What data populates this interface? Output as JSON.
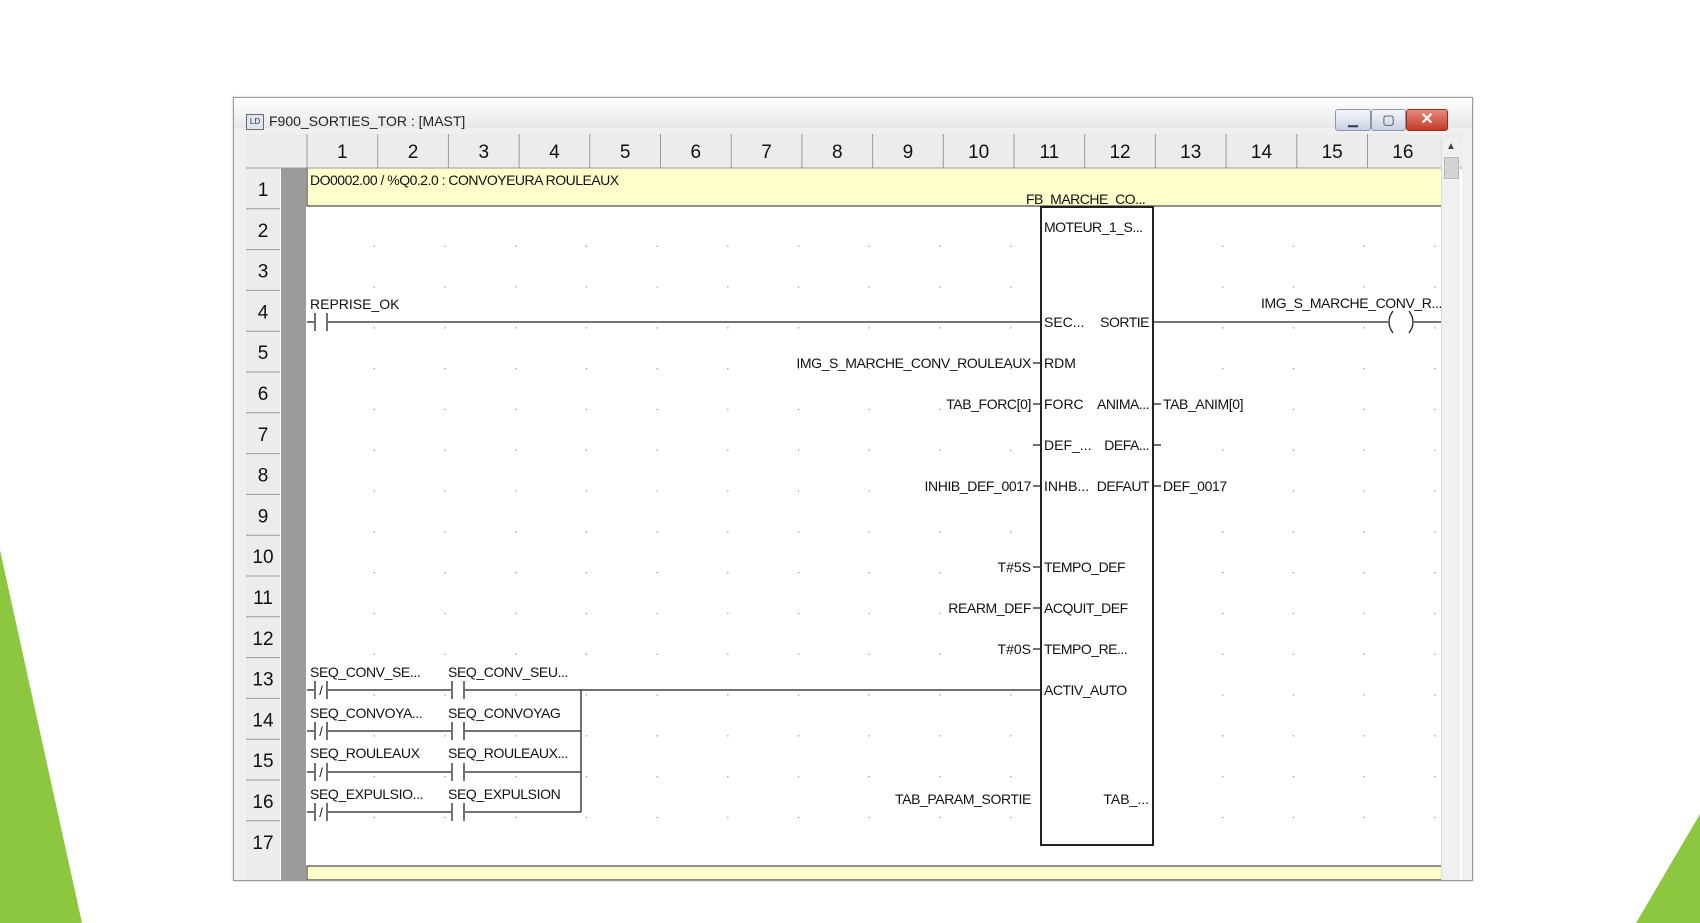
{
  "window": {
    "title": "F900_SORTIES_TOR : [MAST]",
    "icon": "ladder-editor-icon",
    "minimize_icon": "minimize-icon",
    "maximize_icon": "maximize-icon",
    "close_icon": "close-icon"
  },
  "grid": {
    "column_headers": [
      "1",
      "2",
      "3",
      "4",
      "5",
      "6",
      "7",
      "8",
      "9",
      "10",
      "11",
      "12",
      "13",
      "14",
      "15",
      "16"
    ],
    "row_headers": [
      "1",
      "2",
      "3",
      "4",
      "5",
      "6",
      "7",
      "8",
      "9",
      "10",
      "11",
      "12",
      "13",
      "14",
      "15",
      "16",
      "17"
    ]
  },
  "rung": {
    "comment": "DO0002.00 / %Q0.2.0 : CONVOYEURA ROULEAUX"
  },
  "contacts": {
    "reprise": "REPRISE_OK",
    "r13a": "SEQ_CONV_SE...",
    "r13b": "SEQ_CONV_SEU...",
    "r14a": "SEQ_CONVOYA...",
    "r14b": "SEQ_CONVOYAG",
    "r15a": "SEQ_ROULEAUX",
    "r15b": "SEQ_ROULEAUX...",
    "r16a": "SEQ_EXPULSIO...",
    "r16b": "SEQ_EXPULSION",
    "negated_symbol": "/"
  },
  "fb": {
    "instance": "FB_MARCHE_CO...",
    "type": "MOTEUR_1_S...",
    "inputs": {
      "sec": "SEC...",
      "rdm": "RDM",
      "forc": "FORC",
      "def": "DEF_...",
      "inhb": "INHB...",
      "tempo_def": "TEMPO_DEF",
      "acquit_def": "ACQUIT_DEF",
      "tempo_re": "TEMPO_RE...",
      "activ_auto": "ACTIV_AUTO"
    },
    "outputs": {
      "sortie": "SORTIE",
      "anima": "ANIMA...",
      "defa": "DEFA...",
      "defaut": "DEFAUT",
      "tab": "TAB_..."
    }
  },
  "vars": {
    "rdm": "IMG_S_MARCHE_CONV_ROULEAUX",
    "forc": "TAB_FORC[0]",
    "inhb": "INHIB_DEF_0017",
    "tempo_def": "T#5S",
    "acquit": "REARM_DEF",
    "tempo_re": "T#0S",
    "tab_param": "TAB_PARAM_SORTIE",
    "anim": "TAB_ANIM[0]",
    "defaut": "DEF_0017"
  },
  "coil": {
    "label": "IMG_S_MARCHE_CONV_R..."
  },
  "colors": {
    "comment_bg": "#ffffcc",
    "left_rail": "#9b9b9b",
    "close_button": "#c8412f",
    "slide_accent": "#8dc63f"
  }
}
